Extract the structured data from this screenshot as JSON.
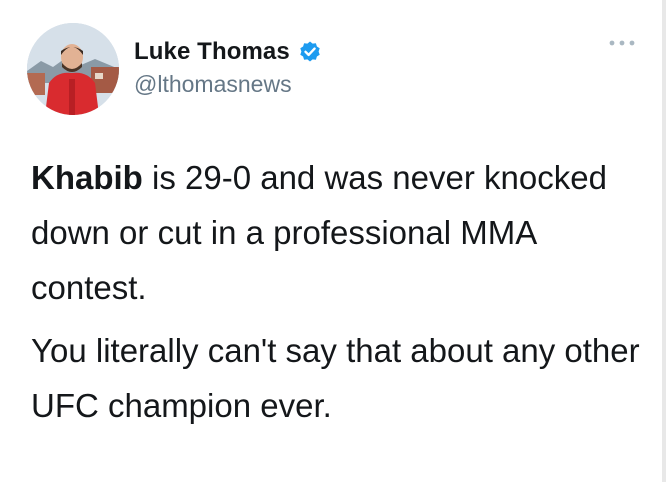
{
  "author": {
    "display_name": "Luke Thomas",
    "handle": "@lthomasnews",
    "verified": true
  },
  "icons": {
    "verified": "verified-badge-icon",
    "more": "more-options-icon",
    "avatar": "avatar-photo"
  },
  "tweet": {
    "paragraph_1_bold": "Khabib",
    "paragraph_1_rest": " is 29-0 and was never knocked down or cut in a professional MMA contest.",
    "paragraph_2": "You literally can't say that about any other UFC champion ever."
  },
  "colors": {
    "verified_blue": "#1d9bf0",
    "handle_gray": "#657786",
    "text": "#14171a"
  }
}
